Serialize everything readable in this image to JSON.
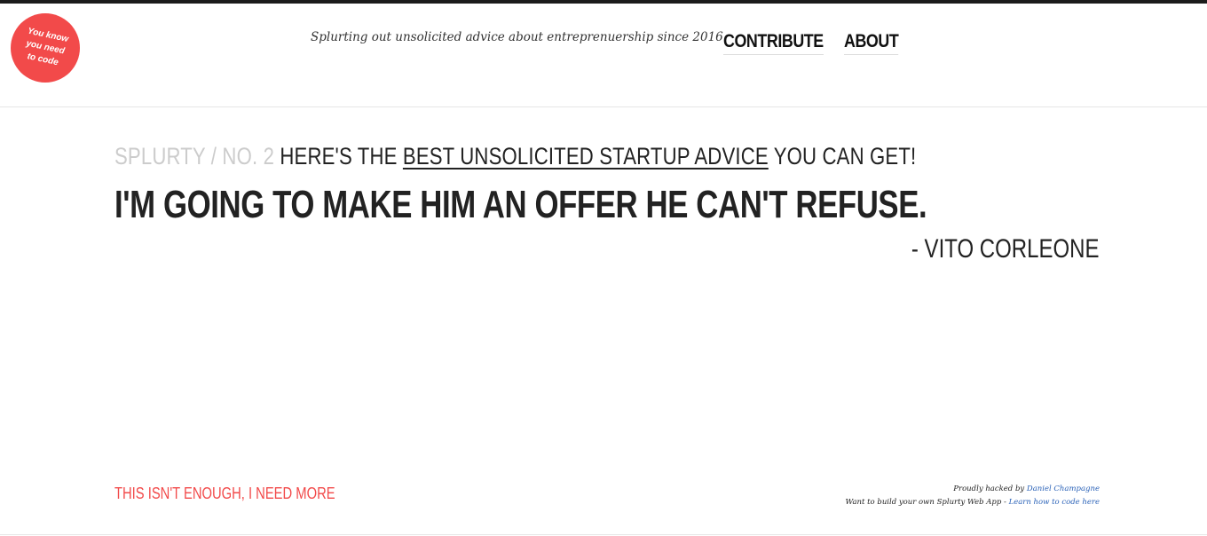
{
  "logo": {
    "text": "You know you need to code",
    "color": "#f24a4a"
  },
  "header": {
    "tagline": "Splurting out unsolicited advice about entreprenuership since 2016",
    "nav": {
      "contribute": "CONTRIBUTE",
      "about": "ABOUT"
    }
  },
  "splurty": {
    "label": "SPLURTY / NO. 2",
    "intro_before": "HERE'S THE",
    "intro_link": "BEST UNSOLICITED STARTUP ADVICE",
    "intro_after": "YOU CAN GET!",
    "quote": "I'M GOING TO MAKE HIM AN OFFER HE CAN'T REFUSE.",
    "author": "- VITO CORLEONE"
  },
  "footer": {
    "more_link": "THIS ISN'T ENOUGH, I NEED MORE",
    "hacked_by_text": "Proudly hacked by",
    "hacked_by_name": "Daniel Champagne",
    "build_text": "Want to build your own Splurty Web App -",
    "learn_link": "Learn how to code here"
  },
  "colors": {
    "accent": "#f24a4a",
    "text": "#222222",
    "muted": "#cccccc",
    "link_blue": "#2a62b8",
    "topbar": "#1c1c1c"
  }
}
